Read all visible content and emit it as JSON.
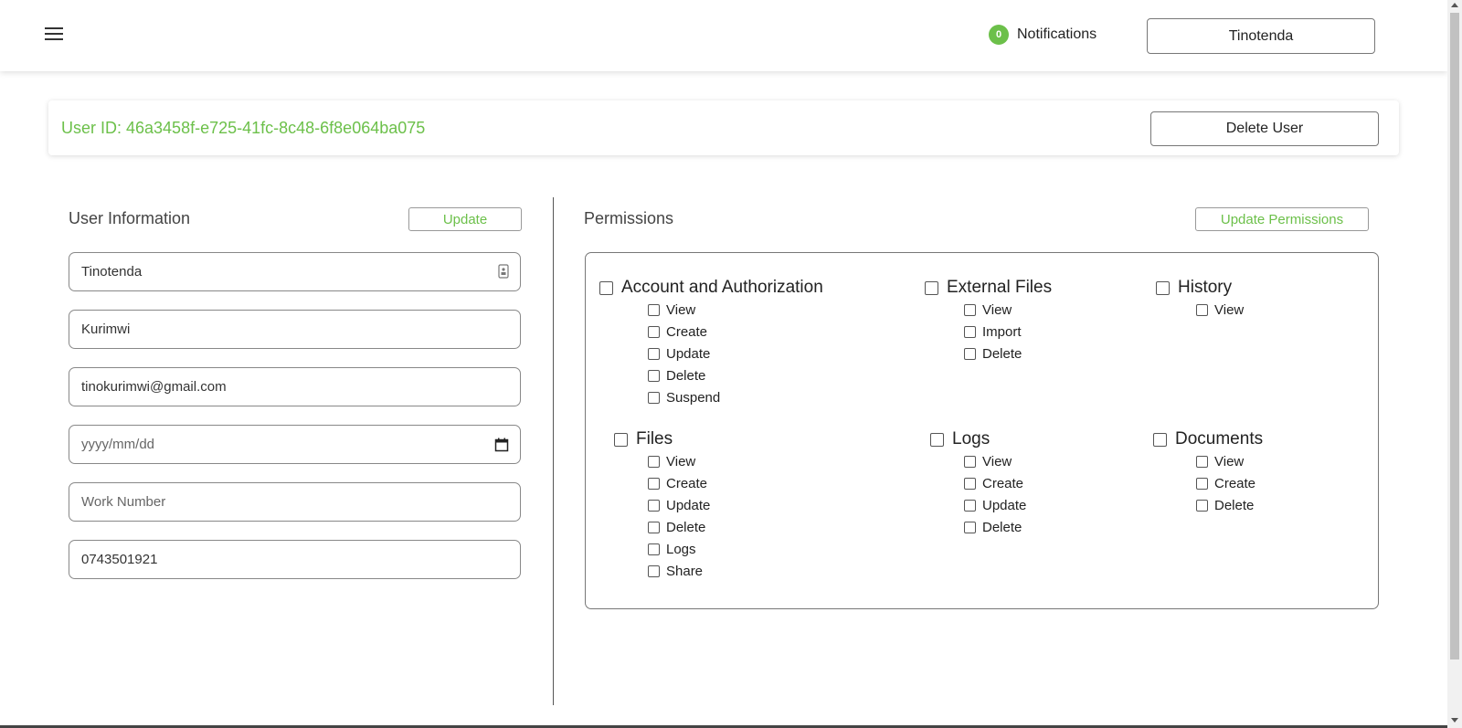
{
  "header": {
    "notifications_count": "0",
    "notifications_label": "Notifications",
    "user_button": "Tinotenda",
    "accent_color": "#6cc04a"
  },
  "user_card": {
    "user_id": "User ID: 46a3458f-e725-41fc-8c48-6f8e064ba075",
    "delete_label": "Delete User"
  },
  "user_info": {
    "title": "User Information",
    "update_label": "Update",
    "fields": [
      {
        "value": "Tinotenda",
        "placeholder": ""
      },
      {
        "value": "Kurimwi",
        "placeholder": ""
      },
      {
        "value": "tinokurimwi@gmail.com",
        "placeholder": ""
      },
      {
        "value": "",
        "placeholder": "yyyy/mm/dd"
      },
      {
        "value": "",
        "placeholder": "Work Number"
      },
      {
        "value": "0743501921",
        "placeholder": ""
      }
    ]
  },
  "permissions": {
    "title": "Permissions",
    "update_label": "Update Permissions",
    "groups": [
      {
        "name": "Account and Authorization",
        "items": [
          "View",
          "Create",
          "Update",
          "Delete",
          "Suspend"
        ]
      },
      {
        "name": "External Files",
        "items": [
          "View",
          "Import",
          "Delete"
        ]
      },
      {
        "name": "History",
        "items": [
          "View"
        ]
      },
      {
        "name": "Files",
        "items": [
          "View",
          "Create",
          "Update",
          "Delete",
          "Logs",
          "Share"
        ]
      },
      {
        "name": "Logs",
        "items": [
          "View",
          "Create",
          "Update",
          "Delete"
        ]
      },
      {
        "name": "Documents",
        "items": [
          "View",
          "Create",
          "Delete"
        ]
      }
    ]
  }
}
